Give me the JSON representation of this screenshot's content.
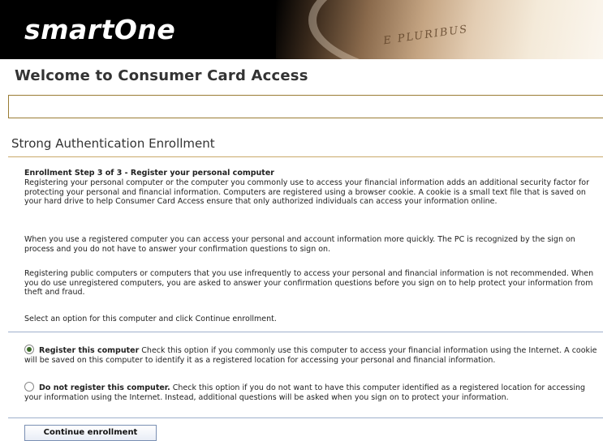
{
  "header": {
    "logo": "smartOne",
    "coin_text": "E PLURIBUS"
  },
  "welcome": "Welcome to Consumer Card Access",
  "section_title": "Strong Authentication Enrollment",
  "step_title": "Enrollment Step 3 of 3 - Register your personal computer",
  "paragraphs": [
    "Registering your personal computer or the computer you commonly use to access your financial information adds an additional security factor for protecting your personal and financial information. Computers are registered using a browser cookie. A cookie is a small text file that is saved on your hard drive to help Consumer Card Access ensure that only authorized individuals can access your information online.",
    "When you use a registered computer you can access your personal and account information more quickly. The PC is recognized by the sign on process and you do not have to answer your confirmation questions to sign on.",
    "Registering public computers or computers that you use infrequently to access your personal and financial information is not recommended. When you do use unregistered computers, you are asked to answer your confirmation questions before you sign on to help protect your information from theft and fraud.",
    "Select an option for this computer and click Continue enrollment."
  ],
  "options": [
    {
      "label": "Register this computer",
      "description": "Check this option if you commonly use this computer to access your financial information using the Internet. A cookie will be saved on this computer to identify it as a registered location for accessing your personal and financial information.",
      "selected": true
    },
    {
      "label": "Do not register this computer.",
      "description": "Check this option if you do not want to have this computer identified as a registered location for accessing your information using the Internet. Instead, additional questions will be asked when you sign on to protect your information.",
      "selected": false
    }
  ],
  "continue_button": "Continue enrollment"
}
